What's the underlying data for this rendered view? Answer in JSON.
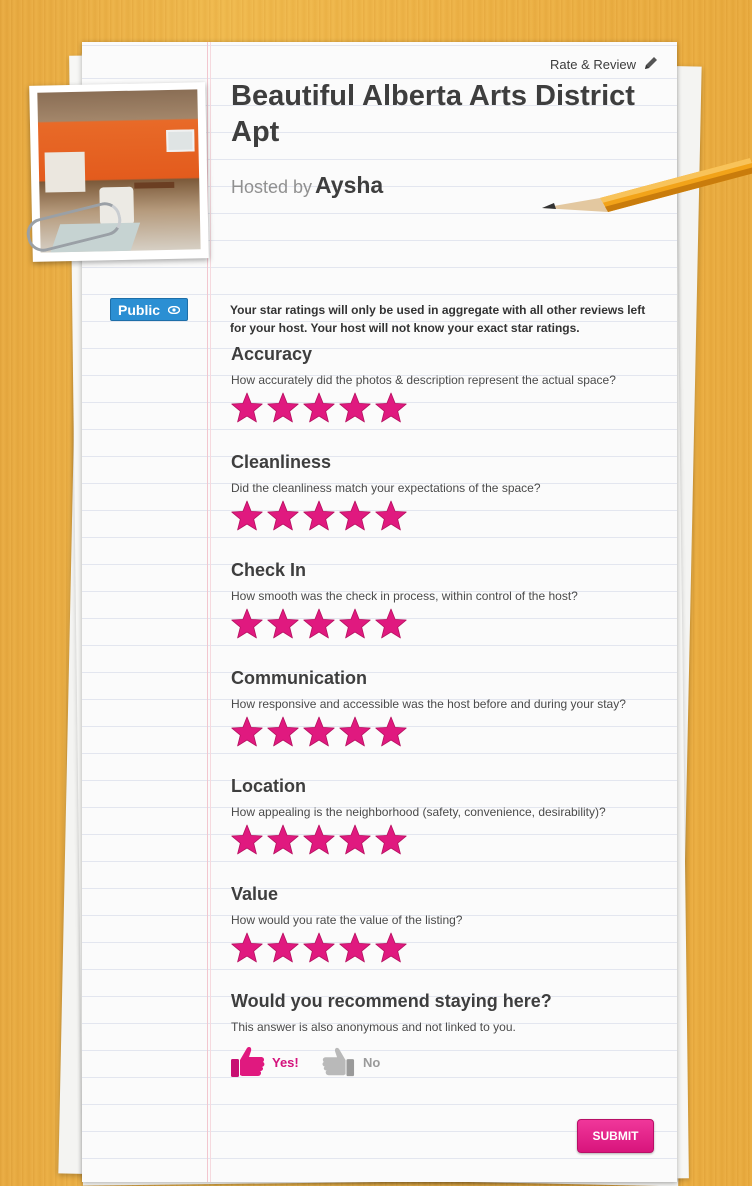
{
  "header": {
    "rate_review_label": "Rate & Review",
    "listing_title": "Beautiful Alberta Arts District Apt",
    "hosted_by_label": "Hosted by",
    "host_name": "Aysha"
  },
  "visibility_badge": {
    "label": "Public",
    "icon": "eye-icon",
    "color": "#2b8fd3"
  },
  "notice": "Your star ratings will only be used in aggregate with all other reviews left for your host. Your host will not know your exact star ratings.",
  "star_color": "#e0197f",
  "categories": [
    {
      "title": "Accuracy",
      "question": "How accurately did the photos & description represent the actual space?",
      "rating": 5,
      "max": 5
    },
    {
      "title": "Cleanliness",
      "question": "Did the cleanliness match your expectations of the space?",
      "rating": 5,
      "max": 5
    },
    {
      "title": "Check In",
      "question": "How smooth was the check in process, within control of the host?",
      "rating": 5,
      "max": 5
    },
    {
      "title": "Communication",
      "question": "How responsive and accessible was the host before and during your stay?",
      "rating": 5,
      "max": 5
    },
    {
      "title": "Location",
      "question": "How appealing is the neighborhood (safety, convenience, desirability)?",
      "rating": 5,
      "max": 5
    },
    {
      "title": "Value",
      "question": "How would you rate the value of the listing?",
      "rating": 5,
      "max": 5
    }
  ],
  "recommend": {
    "title": "Would you recommend staying here?",
    "subtitle": "This answer is also anonymous and not linked to you.",
    "yes_label": "Yes!",
    "no_label": "No",
    "selected": "yes"
  },
  "submit_label": "SUBMIT",
  "accent_color": "#e0197f"
}
